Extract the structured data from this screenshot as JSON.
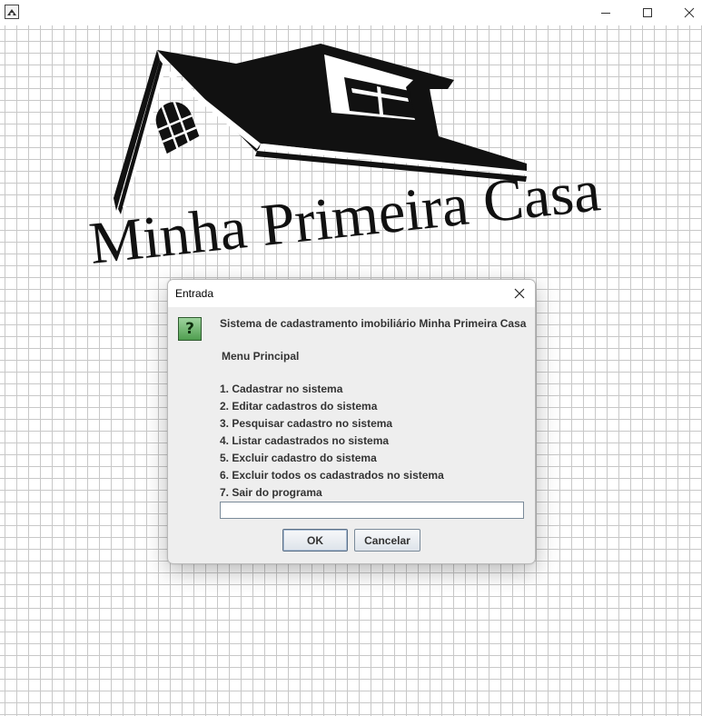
{
  "window": {
    "controls": {
      "minimize": "minimize-icon",
      "maximize": "maximize-icon",
      "close": "close-icon"
    }
  },
  "logo": {
    "text": "Minha Primeira Casa"
  },
  "dialog": {
    "title": "Entrada",
    "icon": "question-icon",
    "icon_glyph": "?",
    "header": "Sistema de cadastramento imobiliário Minha Primeira Casa",
    "menu_title": "Menu Principal",
    "menu_items": [
      "1. Cadastrar no sistema",
      "2. Editar cadastros do sistema",
      "3. Pesquisar cadastro no sistema",
      "4. Listar cadastrados no sistema",
      "5. Excluir cadastro do sistema",
      "6. Excluir todos os cadastrados no sistema",
      "7. Sair do programa"
    ],
    "input_value": "",
    "ok_label": "OK",
    "cancel_label": "Cancelar"
  }
}
